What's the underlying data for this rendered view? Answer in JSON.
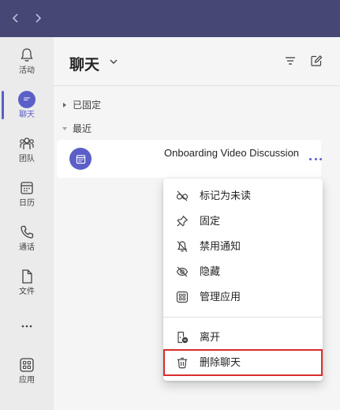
{
  "colors": {
    "titlebar": "#464775",
    "accent": "#5b5fc7",
    "highlight": "#d92c2c"
  },
  "titlebar": {
    "back_icon": "chevron-left-icon",
    "forward_icon": "chevron-right-icon"
  },
  "rail": {
    "items": [
      {
        "label": "活动",
        "icon": "bell-icon"
      },
      {
        "label": "聊天",
        "icon": "chat-icon",
        "active": true
      },
      {
        "label": "团队",
        "icon": "teams-icon"
      },
      {
        "label": "日历",
        "icon": "calendar-icon"
      },
      {
        "label": "通话",
        "icon": "phone-icon"
      },
      {
        "label": "文件",
        "icon": "file-icon"
      },
      {
        "label": "",
        "icon": "more-icon"
      },
      {
        "label": "应用",
        "icon": "apps-icon"
      }
    ]
  },
  "panel": {
    "title": "聊天",
    "filter_icon": "filter-icon",
    "compose_icon": "compose-icon",
    "sections": {
      "pinned": "已固定",
      "recent": "最近"
    },
    "chat": {
      "title": "Onboarding Video Discussion",
      "avatar_icon": "calendar-icon",
      "more_icon": "more-options-icon"
    }
  },
  "menu": {
    "items": [
      {
        "label": "标记为未读",
        "icon": "mark-unread-icon"
      },
      {
        "label": "固定",
        "icon": "pin-icon"
      },
      {
        "label": "禁用通知",
        "icon": "bell-off-icon"
      },
      {
        "label": "隐藏",
        "icon": "eye-off-icon"
      },
      {
        "label": "管理应用",
        "icon": "apps-icon"
      },
      {
        "label": "离开",
        "icon": "leave-icon"
      },
      {
        "label": "删除聊天",
        "icon": "trash-icon",
        "highlighted": true
      }
    ]
  }
}
